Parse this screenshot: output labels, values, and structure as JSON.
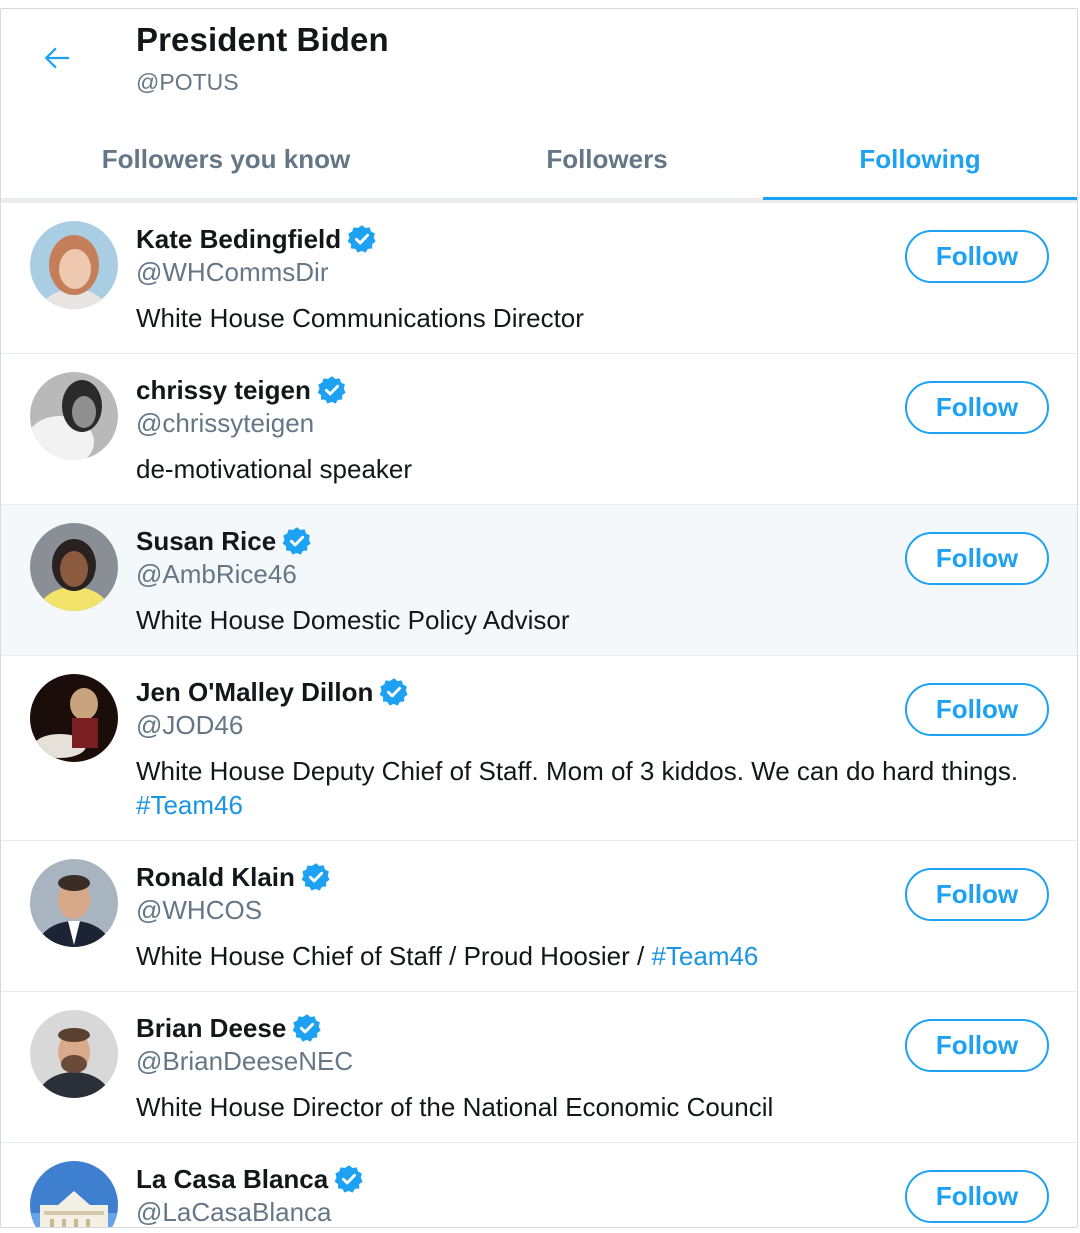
{
  "header": {
    "title": "President Biden",
    "handle": "@POTUS"
  },
  "tabs": [
    {
      "label": "Followers you know",
      "active": false
    },
    {
      "label": "Followers",
      "active": false
    },
    {
      "label": "Following",
      "active": true
    }
  ],
  "colors": {
    "accent": "#1da1f2",
    "secondary_text": "#657786",
    "primary_text": "#14171a",
    "hover_row": "#f5f8fa"
  },
  "users": [
    {
      "name": "Kate Bedingfield",
      "handle": "@WHCommsDir",
      "bio": "White House Communications Director",
      "bio_tag": "",
      "verified": true,
      "follow_label": "Follow"
    },
    {
      "name": "chrissy teigen",
      "handle": "@chrissyteigen",
      "bio": "de-motivational speaker",
      "bio_tag": "",
      "verified": true,
      "follow_label": "Follow"
    },
    {
      "name": "Susan Rice",
      "handle": "@AmbRice46",
      "bio": "White House Domestic Policy Advisor",
      "bio_tag": "",
      "verified": true,
      "follow_label": "Follow"
    },
    {
      "name": "Jen O'Malley Dillon",
      "handle": "@JOD46",
      "bio": "White House Deputy Chief of Staff. Mom of 3 kiddos. We can do hard things. ",
      "bio_tag": "#Team46",
      "verified": true,
      "follow_label": "Follow"
    },
    {
      "name": "Ronald Klain",
      "handle": "@WHCOS",
      "bio": "White House Chief of Staff / Proud Hoosier / ",
      "bio_tag": "#Team46",
      "verified": true,
      "follow_label": "Follow"
    },
    {
      "name": "Brian Deese",
      "handle": "@BrianDeeseNEC",
      "bio": "White House Director of the National Economic Council",
      "bio_tag": "",
      "verified": true,
      "follow_label": "Follow"
    },
    {
      "name": "La Casa Blanca",
      "handle": "@LaCasaBlanca",
      "bio": "",
      "bio_tag": "",
      "verified": true,
      "follow_label": "Follow"
    }
  ]
}
